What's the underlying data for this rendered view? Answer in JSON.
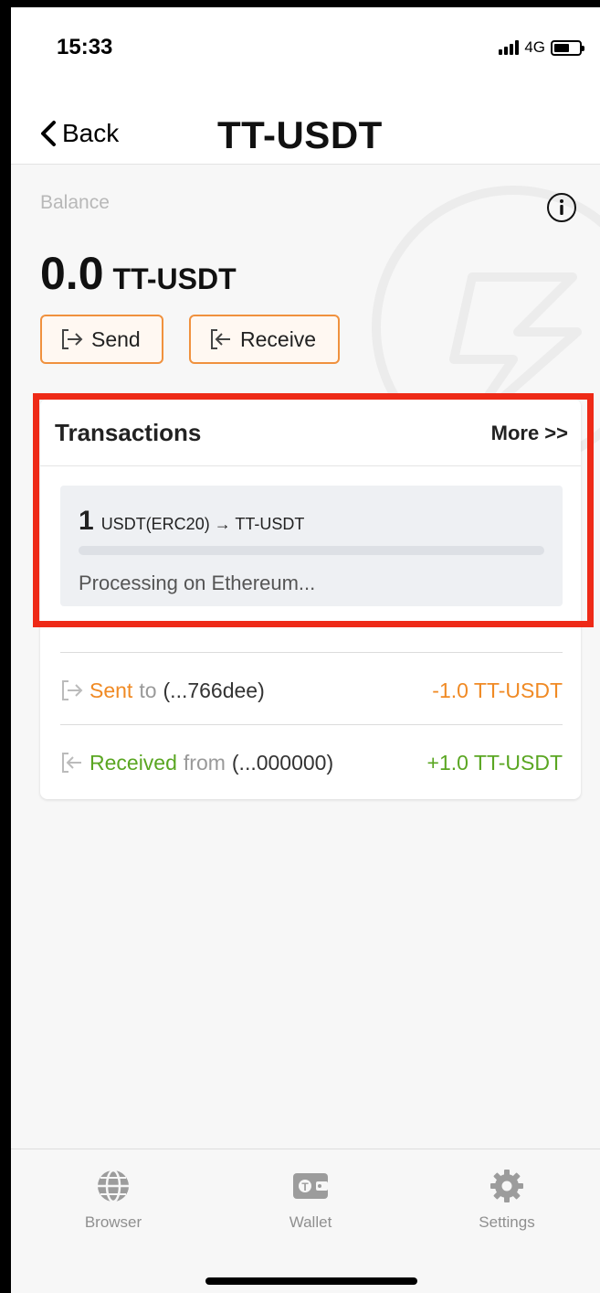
{
  "status": {
    "time": "15:33",
    "network": "4G",
    "battery_level": 0.6
  },
  "nav": {
    "back_label": "Back",
    "title": "TT-USDT"
  },
  "balance": {
    "label": "Balance",
    "amount": "0.0",
    "unit": "TT-USDT"
  },
  "actions": {
    "send_label": "Send",
    "receive_label": "Receive"
  },
  "transactions": {
    "title": "Transactions",
    "more_label": "More >>",
    "pending": {
      "amount": "1",
      "pair": "USDT(ERC20) → TT-USDT",
      "status": "Processing on Ethereum...",
      "progress": 0.0
    },
    "items": [
      {
        "kind": "Sent",
        "prep": "to",
        "party": "(...766dee)",
        "amount": "-1.0 TT-USDT",
        "direction": "out"
      },
      {
        "kind": "Received",
        "prep": "from",
        "party": "(...000000)",
        "amount": "+1.0 TT-USDT",
        "direction": "in"
      }
    ]
  },
  "tabs": [
    {
      "label": "Browser",
      "icon": "globe-icon"
    },
    {
      "label": "Wallet",
      "icon": "wallet-icon"
    },
    {
      "label": "Settings",
      "icon": "gear-icon"
    }
  ],
  "colors": {
    "accent_orange": "#f0913e",
    "sent": "#f08a24",
    "received": "#5aa622",
    "highlight": "#ee2a17"
  }
}
